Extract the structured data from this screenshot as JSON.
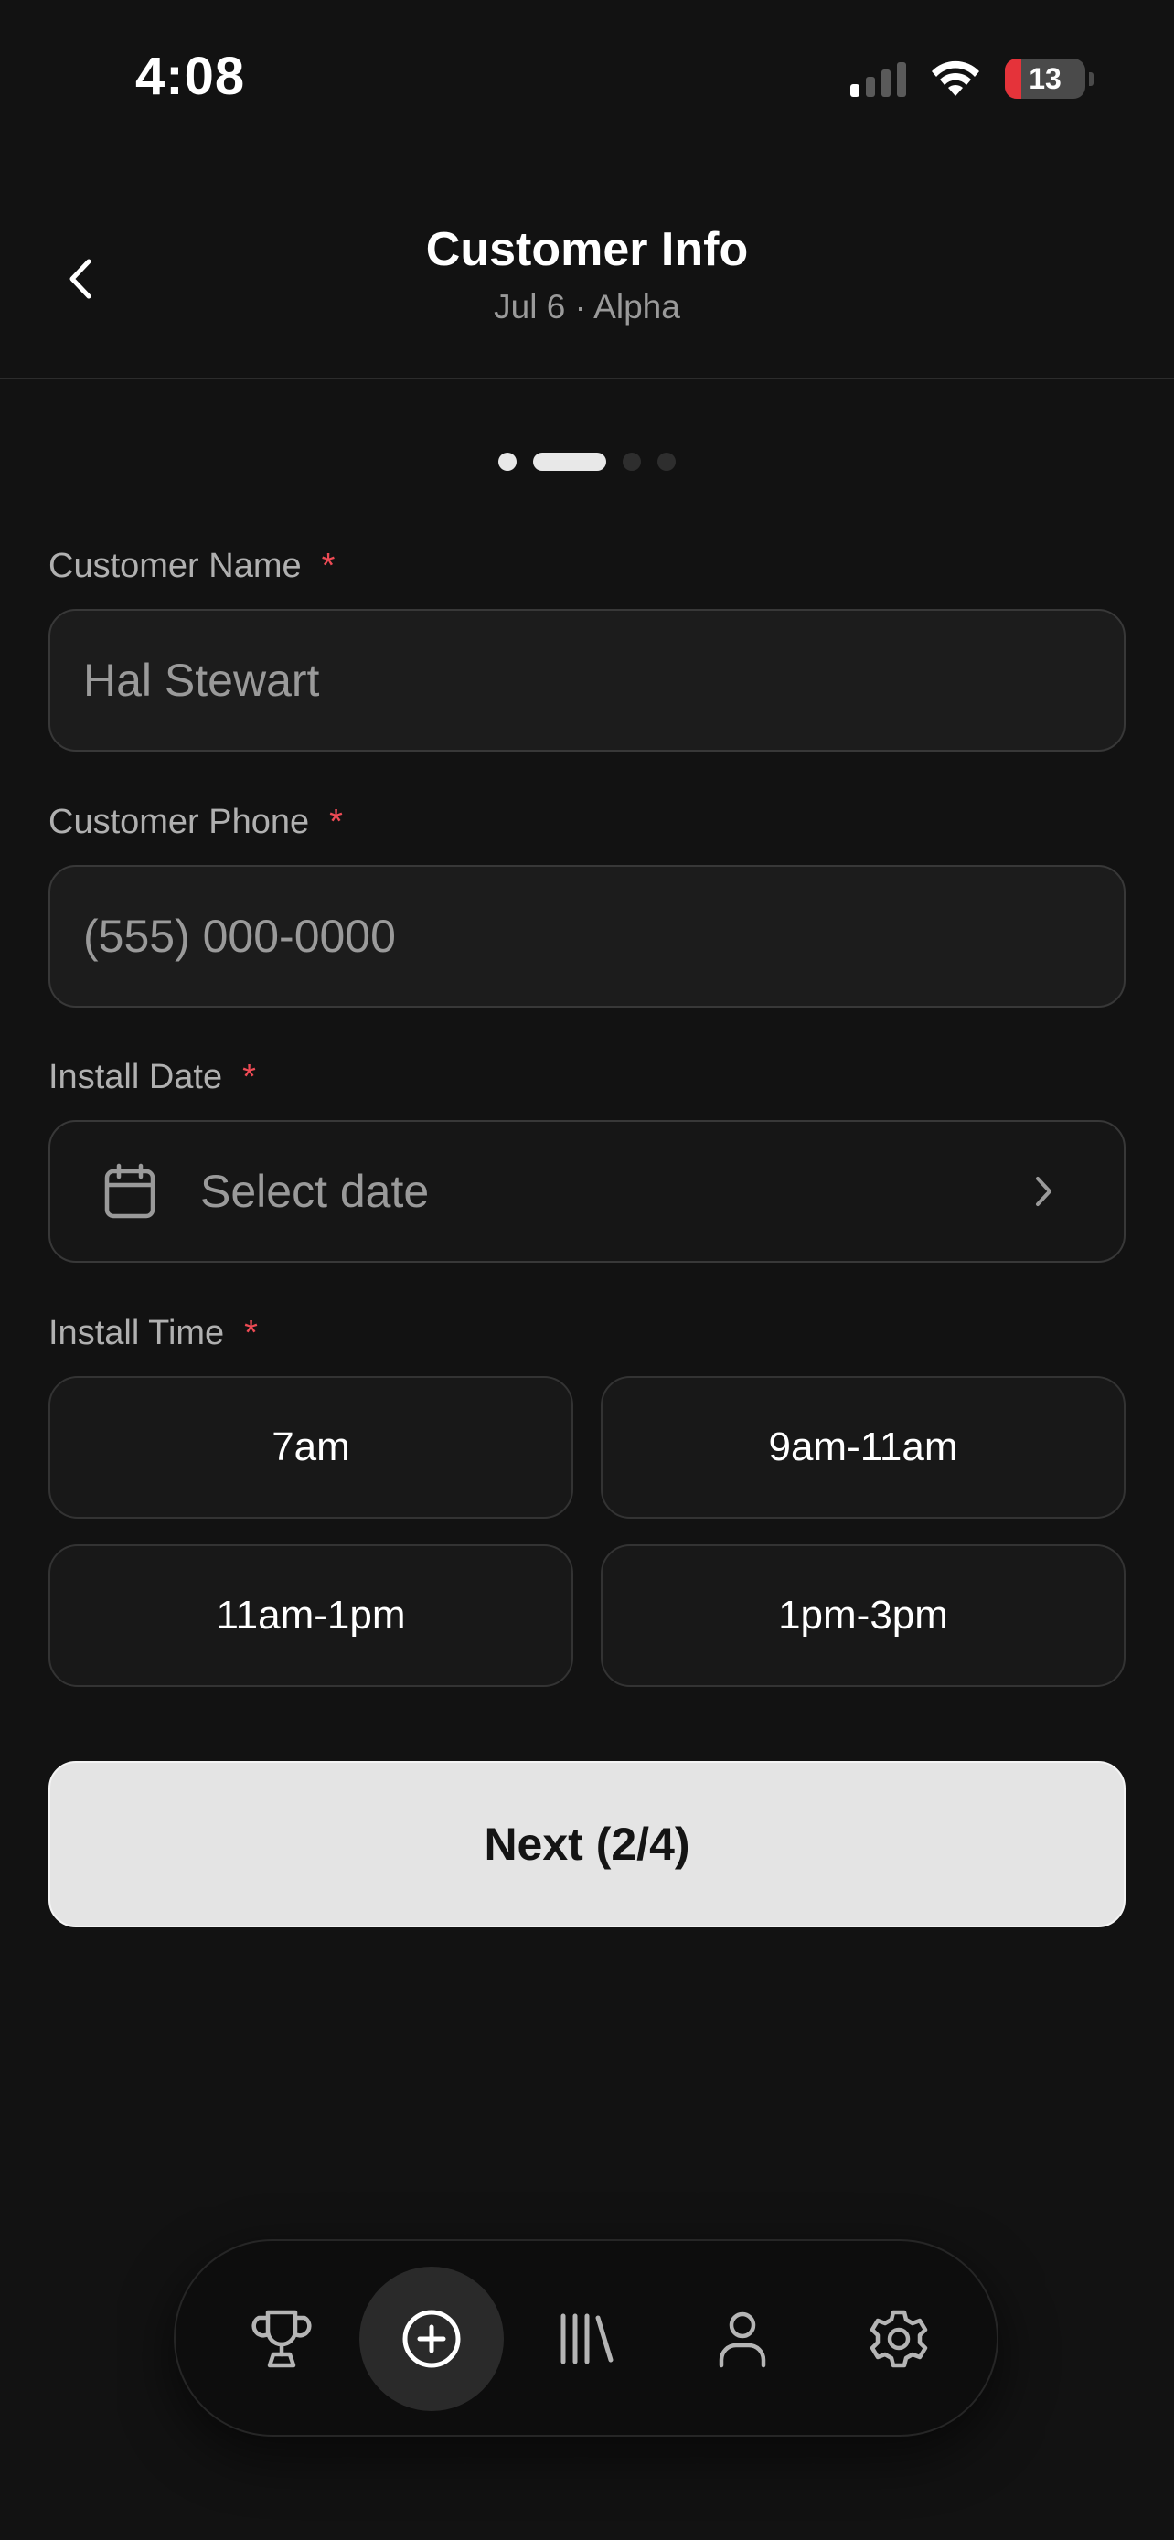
{
  "status_bar": {
    "time": "4:08",
    "battery_level": "13",
    "signal_bars_active": 1,
    "signal_bars_total": 4
  },
  "header": {
    "title": "Customer Info",
    "subtitle": "Jul 6 · Alpha",
    "back_icon": "chevron-left-icon"
  },
  "progress": {
    "current_step": 2,
    "total_steps": 4
  },
  "form": {
    "customer_name": {
      "label": "Customer Name",
      "required_mark": "*",
      "value": "Hal Stewart"
    },
    "customer_phone": {
      "label": "Customer Phone",
      "required_mark": "*",
      "placeholder": "(555) 000-0000"
    },
    "install_date": {
      "label": "Install Date",
      "required_mark": "*",
      "placeholder": "Select date",
      "icon": "calendar-icon"
    },
    "install_time": {
      "label": "Install Time",
      "required_mark": "*",
      "options": [
        "7am",
        "9am-11am",
        "11am-1pm",
        "1pm-3pm"
      ]
    }
  },
  "next_button": {
    "label": "Next (2/4)"
  },
  "bottom_nav": {
    "items": [
      {
        "icon": "trophy-icon",
        "active": false
      },
      {
        "icon": "plus-circle-icon",
        "active": true
      },
      {
        "icon": "library-icon",
        "active": false
      },
      {
        "icon": "person-icon",
        "active": false
      },
      {
        "icon": "gear-icon",
        "active": false
      }
    ]
  },
  "colors": {
    "background": "#121212",
    "required": "#ee4b55",
    "primary_button": "#e4e4e4",
    "battery_low": "#e5333a"
  }
}
